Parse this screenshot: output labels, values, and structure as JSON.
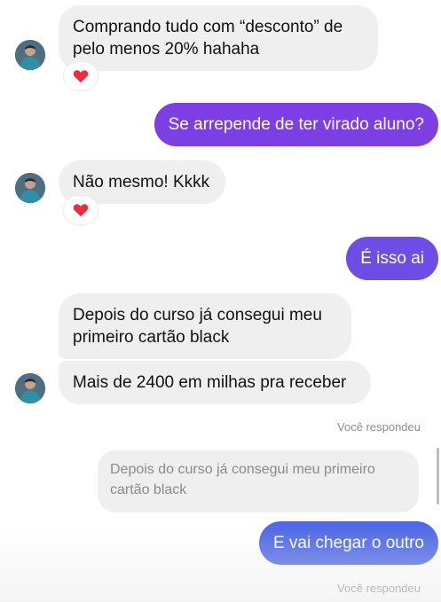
{
  "messages": {
    "m1": {
      "text": "Comprando tudo com “desconto” de pelo menos 20% hahaha",
      "reaction": "heart"
    },
    "m2": {
      "text": "Se arrepende de ter virado aluno?"
    },
    "m3": {
      "text": "Não mesmo! Kkkk",
      "reaction": "heart"
    },
    "m4": {
      "text": "É isso ai"
    },
    "m5": {
      "text": "Depois do curso já consegui meu primeiro cartão black"
    },
    "m6": {
      "text": "Mais de 2400 em milhas pra receber"
    },
    "reply_label_1": "Você respondeu",
    "quoted": "Depois do curso já consegui meu primeiro cartão black",
    "m7": {
      "text": "E vai chegar o outro"
    },
    "reply_label_2": "Você respondeu"
  },
  "colors": {
    "incoming_bubble": "#efefef",
    "outgoing_purple": "#7b3fe4",
    "outgoing_violet": "#6e4ce6",
    "outgoing_blue": "#4d67e6",
    "heart": "#ef2b3d"
  },
  "icons": {
    "avatar": "contact-avatar-icon",
    "reaction": "heart-icon"
  }
}
